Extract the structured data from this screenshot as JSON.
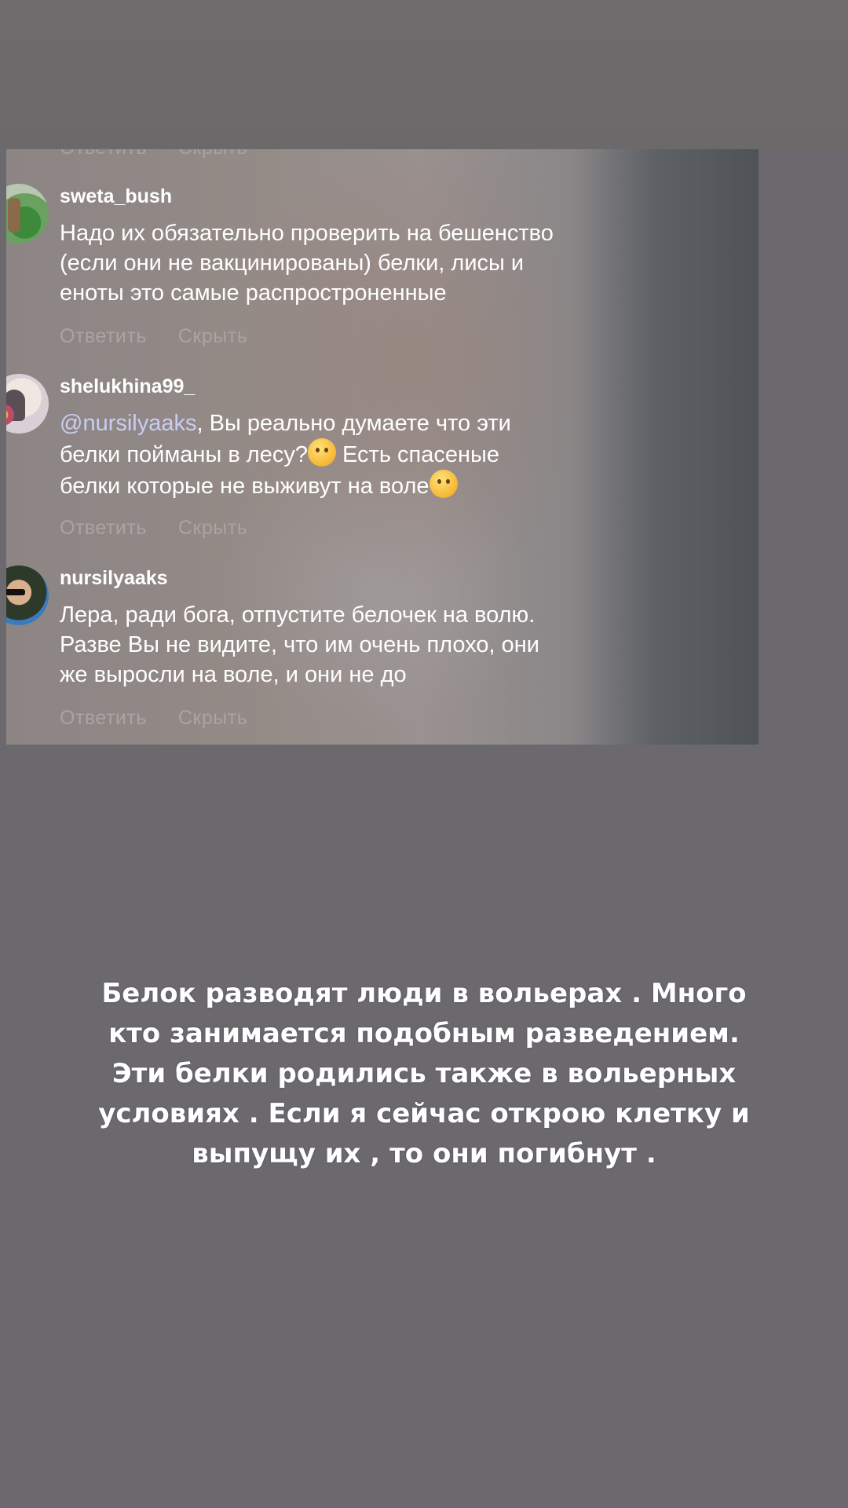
{
  "comments_card": {
    "cut_actions": {
      "reply": "Ответить",
      "hide": "Скрыть"
    },
    "comments": [
      {
        "username": "sweta_bush",
        "text": [
          "Надо их обязательно проверить на бешенство",
          "(если они не вакцинированы) белки, лисы и",
          "еноты это самые распростроненные"
        ],
        "reply": "Ответить",
        "hide": "Скрыть"
      },
      {
        "username": "shelukhina99_",
        "mention": "@nursilyaaks",
        "text": [
          ", Вы реально думаете что эти",
          "белки пойманы в лесу?",
          " Есть спасеные",
          "белки которые не выживут на воле"
        ],
        "emojis": [
          "thinking-face-emoji",
          "winking-face-emoji"
        ],
        "reply": "Ответить",
        "hide": "Скрыть"
      },
      {
        "username": "nursilyaaks",
        "text": [
          "Лера, ради бога, отпустите белочек на волю.",
          "Разве Вы не видите, что им очень плохо, они",
          "же выросли на воле, и они не до"
        ],
        "reply": "Ответить",
        "hide": "Скрыть"
      }
    ]
  },
  "caption": {
    "lines": [
      "Белок разводят люди в вольерах . Много",
      "кто занимается подобным разведением.",
      "Эти белки родились также в вольерных",
      "условиях . Если я сейчас открою клетку и",
      "выпущу их , то они погибнут ."
    ]
  }
}
